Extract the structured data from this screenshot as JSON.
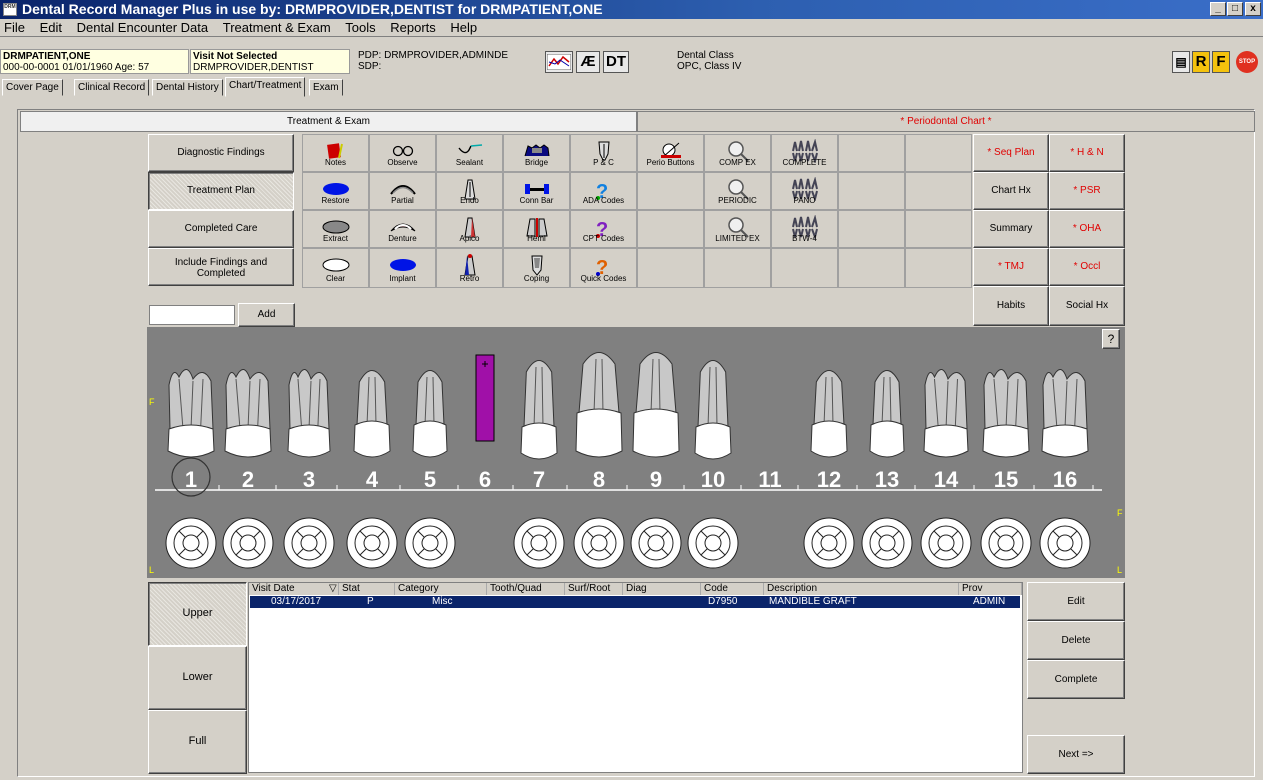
{
  "window": {
    "title": "Dental Record Manager Plus in use by: DRMPROVIDER,DENTIST for DRMPATIENT,ONE",
    "logo": "DRM",
    "minimize": "_",
    "restore": "□",
    "close": "x"
  },
  "menu": [
    "File",
    "Edit",
    "Dental Encounter Data",
    "Treatment & Exam",
    "Tools",
    "Reports",
    "Help"
  ],
  "patient": {
    "name": "DRMPATIENT,ONE",
    "id_line": "000-00-0001   01/01/1960 Age:  57"
  },
  "visit": {
    "status": "Visit Not Selected",
    "provider": "DRMPROVIDER,DENTIST"
  },
  "prov": {
    "pdp": "PDP: DRMPROVIDER,ADMINDE",
    "sdp": "SDP:"
  },
  "toolbar_icons": {
    "ae": "Æ",
    "dt": "DT",
    "r": "R",
    "f": "F",
    "stop": "STOP"
  },
  "dental_class": {
    "line1": "Dental Class",
    "line2": "OPC, Class IV"
  },
  "tabs": [
    "Cover Page",
    "Clinical Record",
    "Dental History",
    "Chart/Treatment",
    "Exam"
  ],
  "subtabs": {
    "left": "Treatment & Exam",
    "right": "* Periodontal Chart *"
  },
  "modes": {
    "diag": "Diagnostic Findings",
    "treat": "Treatment Plan",
    "completed": "Completed Care",
    "include": "Include Findings and Completed",
    "add": "Add",
    "add_value": ""
  },
  "grid_cells": {
    "notes": "Notes",
    "observe": "Observe",
    "sealant": "Sealant",
    "bridge": "Bridge",
    "pc": "P & C",
    "perio": "Perio Buttons",
    "compex": "COMP EX",
    "complete": "COMPLETE",
    "restore": "Restore",
    "partial": "Partial",
    "endo": "Endo",
    "connbar": "Conn Bar",
    "ada": "ADA Codes",
    "periodic": "PERIODIC",
    "pano": "PANO",
    "extract": "Extract",
    "denture": "Denture",
    "apico": "Apico",
    "hemi": "Hemi",
    "cpt": "CPT Codes",
    "limited": "LIMITED EX",
    "btw": "BTW-4",
    "clear": "Clear",
    "implant": "Implant",
    "retro": "Retro",
    "coping": "Coping",
    "quick": "Quick Codes"
  },
  "right_btns": {
    "seqplan": "* Seq Plan",
    "hn": "* H & N",
    "charthx": "Chart Hx",
    "psr": "* PSR",
    "summary": "Summary",
    "oha": "* OHA",
    "tmj": "* TMJ",
    "occl": "* Occl",
    "habits": "Habits",
    "socialhx": "Social Hx"
  },
  "chart": {
    "teeth": [
      "1",
      "2",
      "3",
      "4",
      "5",
      "6",
      "7",
      "8",
      "9",
      "10",
      "11",
      "12",
      "13",
      "14",
      "15",
      "16"
    ],
    "f_left": "F",
    "f_right": "F",
    "l_left": "L",
    "l_right": "L",
    "key": "?"
  },
  "arch": {
    "upper": "Upper",
    "lower": "Lower",
    "full": "Full"
  },
  "table": {
    "headers": {
      "visit_date": "Visit Date",
      "stat": "Stat",
      "category": "Category",
      "tooth": "Tooth/Quad",
      "surf": "Surf/Root",
      "diag": "Diag",
      "code": "Code",
      "desc": "Description",
      "prov": "Prov"
    },
    "row": {
      "visit_date": "03/17/2017",
      "stat": "P",
      "category": "Misc",
      "tooth": "",
      "surf": "",
      "diag": "",
      "code": "D7950",
      "desc": "MANDIBLE GRAFT",
      "prov": "ADMIN"
    }
  },
  "actions": {
    "edit": "Edit",
    "delete": "Delete",
    "complete": "Complete",
    "next": "Next =>"
  }
}
